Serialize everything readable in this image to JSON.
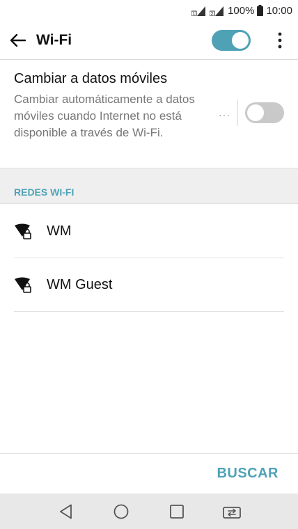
{
  "status_bar": {
    "battery": "100%",
    "time": "10:00"
  },
  "app_bar": {
    "title": "Wi-Fi",
    "wifi_enabled": true
  },
  "mobile_data_switch": {
    "title": "Cambiar a datos móviles",
    "description": "Cambiar automáticamente a datos móviles cuando Internet no está disponible a través de Wi-Fi.",
    "more": "···",
    "enabled": false
  },
  "networks_section": {
    "header": "REDES WI-FI",
    "items": [
      {
        "name": "WM",
        "icon": "wifi-lock-icon"
      },
      {
        "name": "WM Guest",
        "icon": "wifi-lock-icon"
      }
    ]
  },
  "actions": {
    "scan_label": "BUSCAR"
  },
  "colors": {
    "accent": "#4fa2b6",
    "toggle_off": "#c9c9c9",
    "nav_bg": "#e8e8e8"
  },
  "nav_bar": {
    "buttons": [
      "back-icon",
      "home-icon",
      "recents-icon",
      "dual-window-icon"
    ]
  }
}
